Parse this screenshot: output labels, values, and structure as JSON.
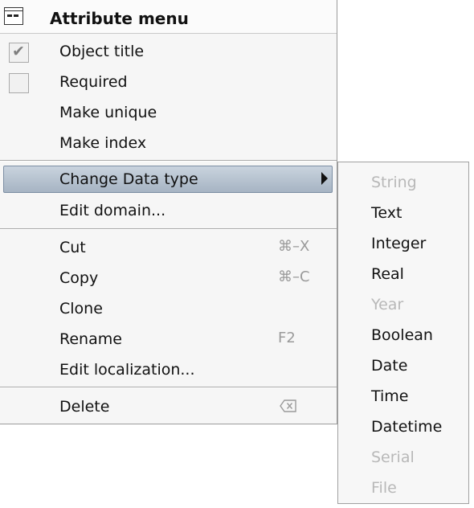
{
  "menu": {
    "title": "Attribute menu",
    "icon": "menu-icon",
    "items_top": [
      {
        "label": "Object title",
        "checkbox": true,
        "checked": true
      },
      {
        "label": "Required",
        "checkbox": true,
        "checked": false
      },
      {
        "label": "Make unique"
      },
      {
        "label": "Make index"
      }
    ],
    "change_type": {
      "label": "Change Data type"
    },
    "edit_domain": {
      "label": "Edit domain..."
    },
    "edit_items": [
      {
        "label": "Cut",
        "shortcut": "⌘–X"
      },
      {
        "label": "Copy",
        "shortcut": "⌘–C"
      },
      {
        "label": "Clone",
        "shortcut": ""
      },
      {
        "label": "Rename",
        "shortcut": "F2"
      },
      {
        "label": "Edit localization...",
        "shortcut": ""
      }
    ],
    "delete": {
      "label": "Delete",
      "icon": "delete-icon"
    }
  },
  "submenu": {
    "items": [
      {
        "label": "String",
        "enabled": false
      },
      {
        "label": "Text",
        "enabled": true
      },
      {
        "label": "Integer",
        "enabled": true
      },
      {
        "label": "Real",
        "enabled": true
      },
      {
        "label": "Year",
        "enabled": false
      },
      {
        "label": "Boolean",
        "enabled": true
      },
      {
        "label": "Date",
        "enabled": true
      },
      {
        "label": "Time",
        "enabled": true
      },
      {
        "label": "Datetime",
        "enabled": true
      },
      {
        "label": "Serial",
        "enabled": false
      },
      {
        "label": "File",
        "enabled": false
      }
    ]
  },
  "colors": {
    "highlight": "#b6c2cf",
    "disabled_text": "#b8b8b8"
  }
}
